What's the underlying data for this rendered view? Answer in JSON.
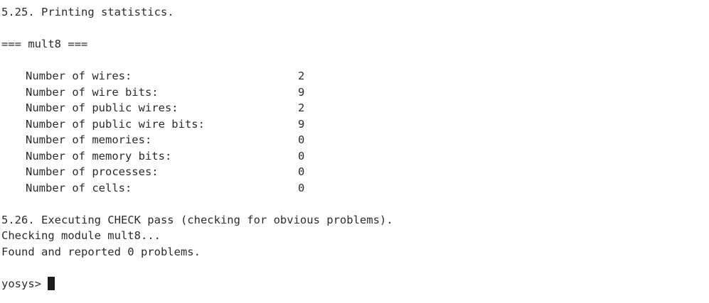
{
  "terminal": {
    "lines_before_stats": [
      "5.25. Printing statistics.",
      "",
      "=== mult8 ===",
      ""
    ],
    "stats": [
      {
        "label": "Number of wires:",
        "value": "2"
      },
      {
        "label": "Number of wire bits:",
        "value": "9"
      },
      {
        "label": "Number of public wires:",
        "value": "2"
      },
      {
        "label": "Number of public wire bits:",
        "value": "9"
      },
      {
        "label": "Number of memories:",
        "value": "0"
      },
      {
        "label": "Number of memory bits:",
        "value": "0"
      },
      {
        "label": "Number of processes:",
        "value": "0"
      },
      {
        "label": "Number of cells:",
        "value": "0"
      }
    ],
    "lines_after_stats": [
      "",
      "5.26. Executing CHECK pass (checking for obvious problems).",
      "Checking module mult8...",
      "Found and reported 0 problems.",
      ""
    ],
    "prompt": "yosys>"
  }
}
